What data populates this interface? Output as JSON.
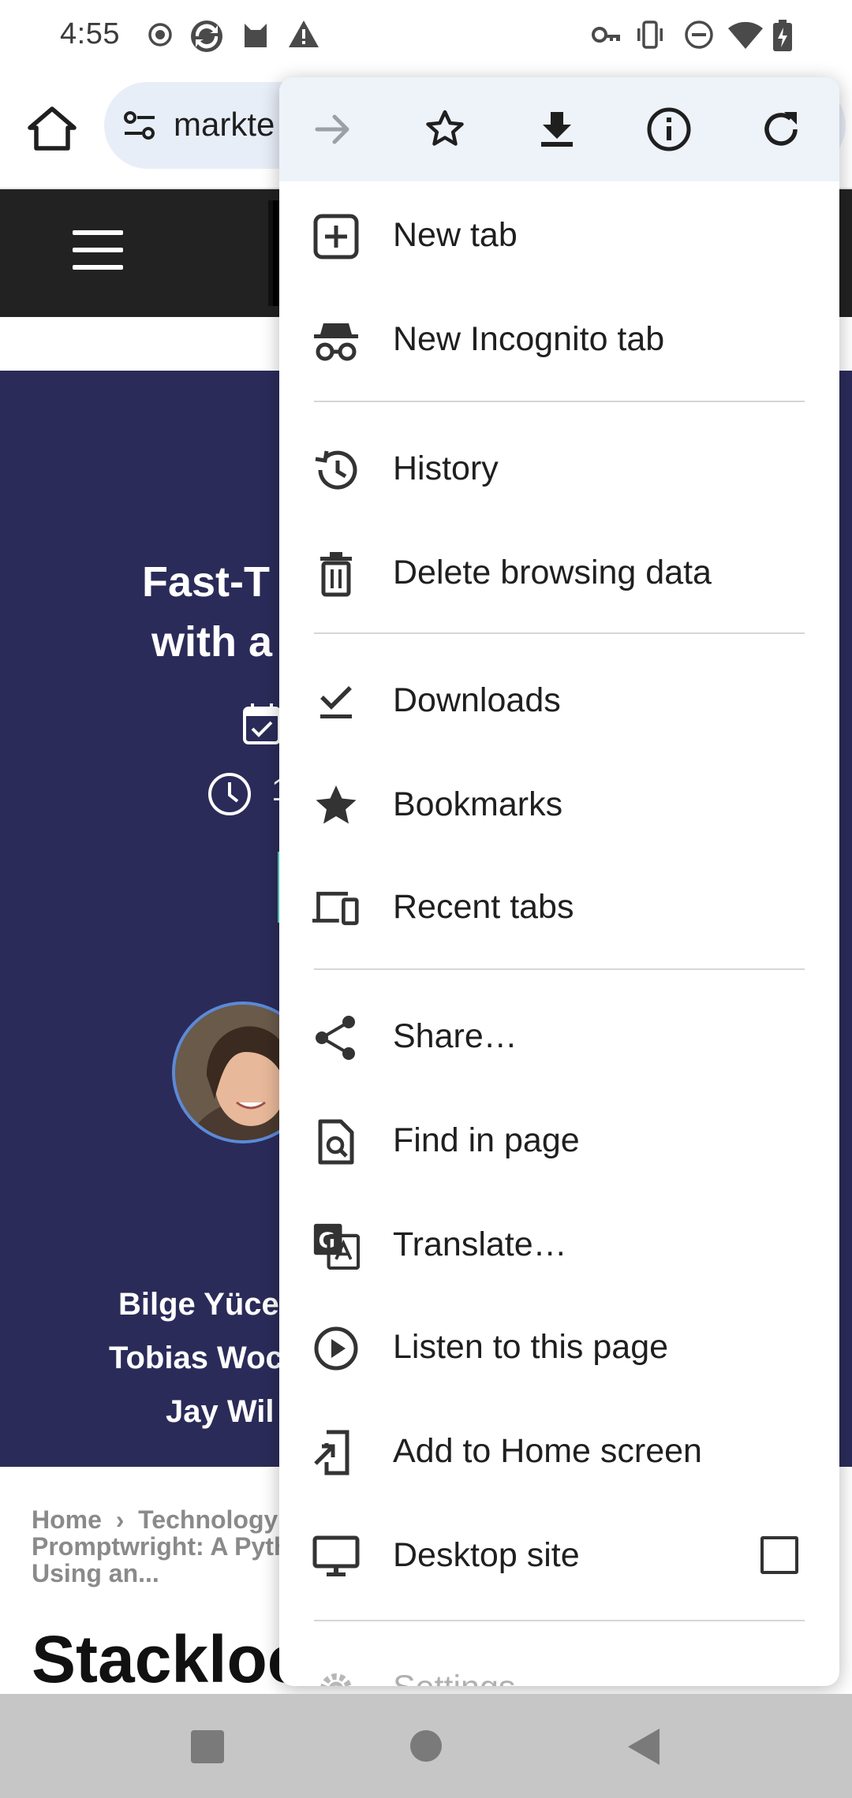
{
  "status_bar": {
    "time": "4:55",
    "left_icons": [
      "record-icon",
      "sync-app-icon",
      "cat-app-icon",
      "warning-icon"
    ],
    "right_icons": [
      "vpn-key-icon",
      "vibrate-icon",
      "do-not-disturb-icon",
      "wifi-icon",
      "battery-charging-icon"
    ]
  },
  "toolbar": {
    "url_text": "markte",
    "home_icon": "home-icon",
    "site_settings_icon": "tune-icon"
  },
  "page": {
    "hero_title_lines": [
      "Fast-T",
      "with a"
    ],
    "hero_time_text": "1",
    "authors": [
      "Bilge Yücel",
      "Tobias Woc",
      "Jay Wil"
    ],
    "breadcrumb_home": "Home",
    "breadcrumb_sep": "›",
    "breadcrumb_category": "Technology",
    "breadcrumb_rest_1": "Promptwright: A Pyth",
    "breadcrumb_rest_2": "Using an...",
    "article_title": "Stackloc"
  },
  "menu": {
    "action_icons": [
      "forward-icon",
      "bookmark-star-icon",
      "download-icon",
      "page-info-icon",
      "refresh-icon"
    ],
    "items": [
      {
        "label": "New tab",
        "icon": "new-tab-icon"
      },
      {
        "label": "New Incognito tab",
        "icon": "incognito-icon"
      },
      {
        "label": "History",
        "icon": "history-icon"
      },
      {
        "label": "Delete browsing data",
        "icon": "trash-icon"
      },
      {
        "label": "Downloads",
        "icon": "downloads-check-icon"
      },
      {
        "label": "Bookmarks",
        "icon": "star-icon"
      },
      {
        "label": "Recent tabs",
        "icon": "devices-icon"
      },
      {
        "label": "Share…",
        "icon": "share-icon"
      },
      {
        "label": "Find in page",
        "icon": "find-in-page-icon"
      },
      {
        "label": "Translate…",
        "icon": "translate-icon"
      },
      {
        "label": "Listen to this page",
        "icon": "play-circle-icon"
      },
      {
        "label": "Add to Home screen",
        "icon": "add-to-home-icon"
      },
      {
        "label": "Desktop site",
        "icon": "desktop-icon",
        "checked": false
      },
      {
        "label": "Settings",
        "icon": "settings-icon"
      }
    ]
  },
  "nav_bar": {
    "buttons": [
      "recents-square-icon",
      "home-circle-icon",
      "back-triangle-icon"
    ]
  }
}
